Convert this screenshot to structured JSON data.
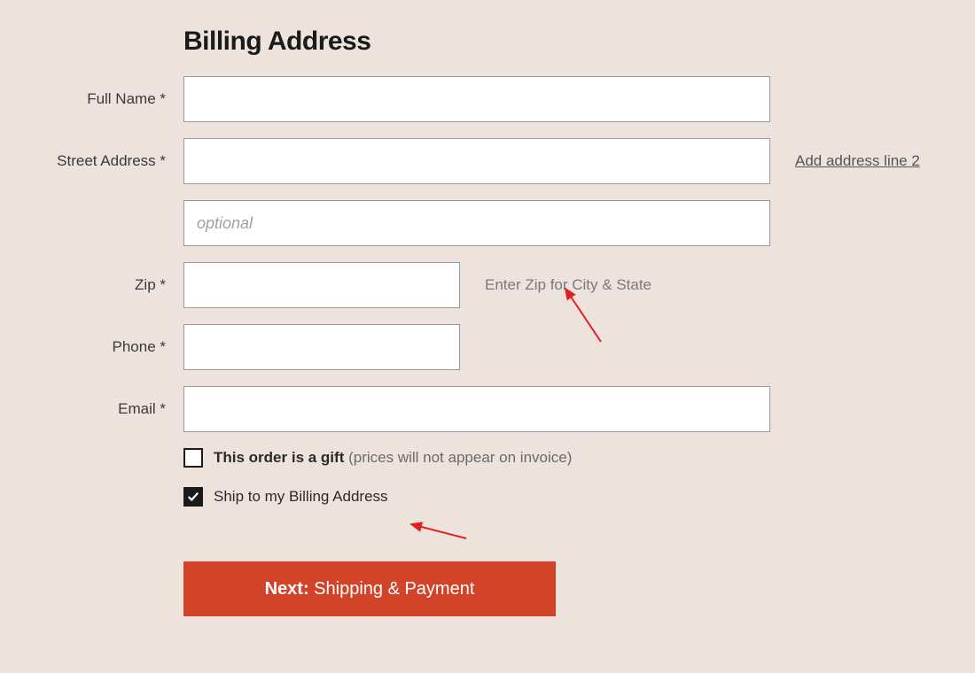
{
  "form": {
    "title": "Billing Address",
    "fields": {
      "full_name": {
        "label": "Full Name *",
        "value": ""
      },
      "street_address": {
        "label": "Street Address *",
        "value": "",
        "add_line_link": "Add address line 2"
      },
      "street_address_2": {
        "placeholder": "optional",
        "value": ""
      },
      "zip": {
        "label": "Zip *",
        "value": "",
        "hint": "Enter Zip for City & State"
      },
      "phone": {
        "label": "Phone *",
        "value": ""
      },
      "email": {
        "label": "Email *",
        "value": ""
      }
    },
    "gift_checkbox": {
      "checked": false,
      "label_bold": "This order is a gift",
      "label_paren": " (prices will not appear on invoice)"
    },
    "ship_billing_checkbox": {
      "checked": true,
      "label": "Ship to my Billing Address"
    },
    "next_button": {
      "prefix": "Next:",
      "rest": " Shipping & Payment"
    }
  }
}
